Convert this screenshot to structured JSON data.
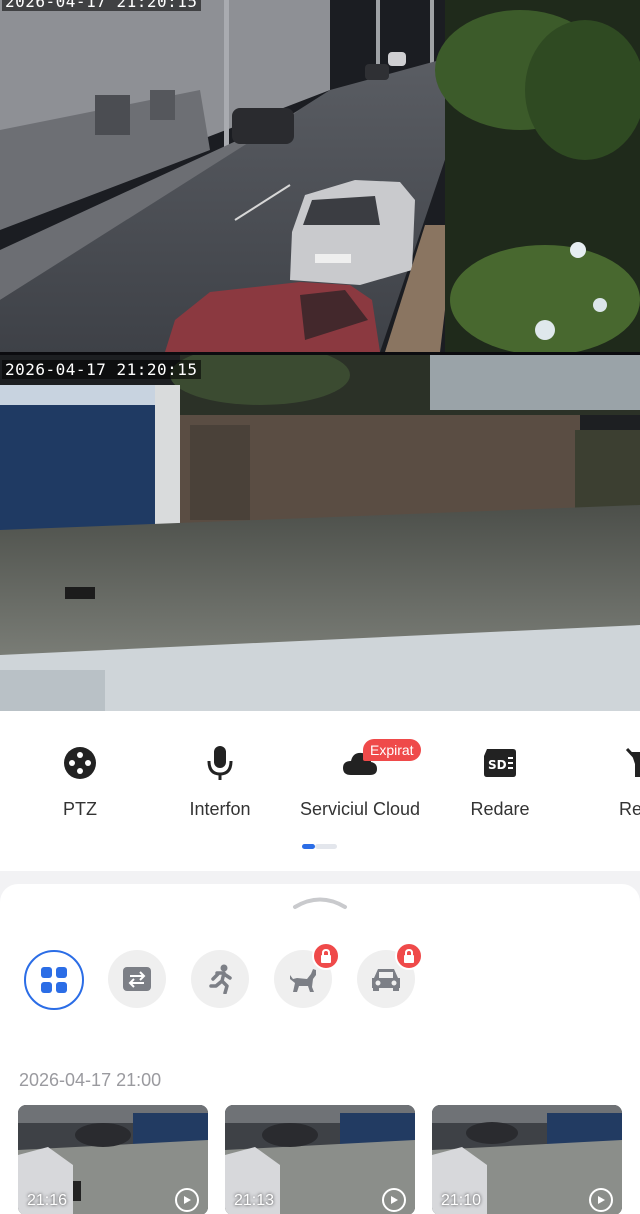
{
  "feeds": [
    {
      "osd_time": "2026-04-17 21:20:15"
    },
    {
      "osd_time": "2026-04-17 21:20:15"
    }
  ],
  "controls": {
    "items": [
      {
        "label": "PTZ",
        "icon": "ptz-joystick-icon"
      },
      {
        "label": "Interfon",
        "icon": "microphone-icon"
      },
      {
        "label": "Serviciul Cloud",
        "icon": "cloud-icon"
      },
      {
        "label": "Redare",
        "icon": "sd-card-icon"
      },
      {
        "label": "Refle",
        "icon": "flashlight-off-icon"
      }
    ],
    "cloud_badge": "Expirat",
    "pager": {
      "active": 1,
      "total": 2
    }
  },
  "events": {
    "filters": [
      {
        "icon": "all-grid-icon",
        "active": true,
        "locked": false
      },
      {
        "icon": "motion-swap-icon",
        "active": false,
        "locked": false
      },
      {
        "icon": "human-running-icon",
        "active": false,
        "locked": false
      },
      {
        "icon": "pet-dog-icon",
        "active": false,
        "locked": true
      },
      {
        "icon": "vehicle-car-icon",
        "active": false,
        "locked": true
      }
    ],
    "section_time": "2026-04-17 21:00",
    "clips": [
      {
        "time": "21:16"
      },
      {
        "time": "21:13"
      },
      {
        "time": "21:10"
      }
    ]
  },
  "colors": {
    "accent": "#2b6de6",
    "badge_red": "#ef4a4a",
    "label": "#333333",
    "muted": "#9a9a9f"
  }
}
